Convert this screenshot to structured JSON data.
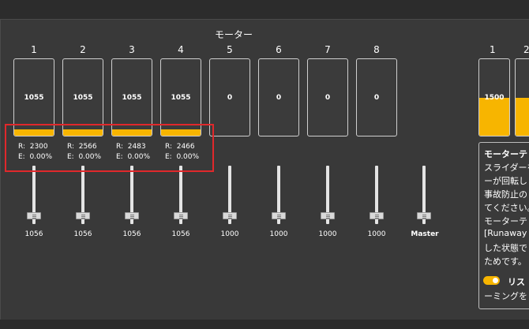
{
  "panel": {
    "title": "モーター"
  },
  "motors": [
    {
      "num": "1",
      "value": "1055",
      "fill_pct": 8
    },
    {
      "num": "2",
      "value": "1055",
      "fill_pct": 8
    },
    {
      "num": "3",
      "value": "1055",
      "fill_pct": 8
    },
    {
      "num": "4",
      "value": "1055",
      "fill_pct": 8
    },
    {
      "num": "5",
      "value": "0",
      "fill_pct": 0
    },
    {
      "num": "6",
      "value": "0",
      "fill_pct": 0
    },
    {
      "num": "7",
      "value": "0",
      "fill_pct": 0
    },
    {
      "num": "8",
      "value": "0",
      "fill_pct": 0
    }
  ],
  "stats": [
    {
      "r": "R:  2300",
      "e": "E:  0.00%"
    },
    {
      "r": "R:  2566",
      "e": "E:  0.00%"
    },
    {
      "r": "R:  2483",
      "e": "E:  0.00%"
    },
    {
      "r": "R:  2466",
      "e": "E:  0.00%"
    }
  ],
  "sliders": [
    {
      "label": "1056"
    },
    {
      "label": "1056"
    },
    {
      "label": "1056"
    },
    {
      "label": "1056"
    },
    {
      "label": "1000"
    },
    {
      "label": "1000"
    },
    {
      "label": "1000"
    },
    {
      "label": "1000"
    }
  ],
  "master": {
    "label": "Master"
  },
  "right_motors": [
    {
      "num": "1",
      "value": "1500"
    },
    {
      "num": "2",
      "value": ""
    }
  ],
  "info_panel": {
    "lines": [
      "モーターテ",
      "スライダーを",
      "ーが回転しま",
      "事故防止の",
      "てください。",
      "モーターテ",
      "[Runaway T",
      "した状態で",
      "ためです。"
    ],
    "toggle_label": "リス",
    "toggle_sub": "ーミングを"
  },
  "colors": {
    "accent": "#f7b500",
    "highlight": "#e0282b",
    "panel_bg": "#393939"
  }
}
